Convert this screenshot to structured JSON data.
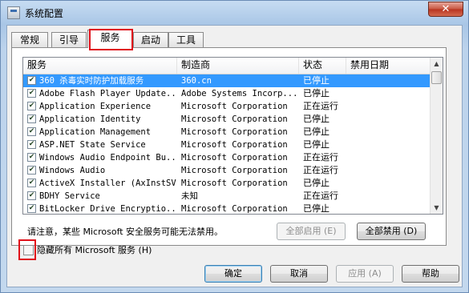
{
  "window": {
    "title": "系统配置",
    "close_glyph": "✕"
  },
  "tabs": [
    {
      "label": "常规"
    },
    {
      "label": "引导"
    },
    {
      "label": "服务"
    },
    {
      "label": "启动"
    },
    {
      "label": "工具"
    }
  ],
  "active_tab": "服务",
  "columns": [
    "服务",
    "制造商",
    "状态",
    "禁用日期"
  ],
  "services": [
    {
      "name": "360 杀毒实时防护加载服务",
      "vendor": "360.cn",
      "status": "已停止",
      "checked": true,
      "selected": true
    },
    {
      "name": "Adobe Flash Player Update...",
      "vendor": "Adobe Systems Incorp...",
      "status": "已停止",
      "checked": true
    },
    {
      "name": "Application Experience",
      "vendor": "Microsoft Corporation",
      "status": "正在运行",
      "checked": true
    },
    {
      "name": "Application Identity",
      "vendor": "Microsoft Corporation",
      "status": "已停止",
      "checked": true
    },
    {
      "name": "Application Management",
      "vendor": "Microsoft Corporation",
      "status": "已停止",
      "checked": true
    },
    {
      "name": "ASP.NET State Service",
      "vendor": "Microsoft Corporation",
      "status": "已停止",
      "checked": true
    },
    {
      "name": "Windows Audio Endpoint Bu...",
      "vendor": "Microsoft Corporation",
      "status": "正在运行",
      "checked": true
    },
    {
      "name": "Windows Audio",
      "vendor": "Microsoft Corporation",
      "status": "正在运行",
      "checked": true
    },
    {
      "name": "ActiveX Installer (AxInstSV)",
      "vendor": "Microsoft Corporation",
      "status": "已停止",
      "checked": true
    },
    {
      "name": "BDHY Service",
      "vendor": "未知",
      "status": "正在运行",
      "checked": true
    },
    {
      "name": "BitLocker Drive Encryptio...",
      "vendor": "Microsoft Corporation",
      "status": "已停止",
      "checked": true
    }
  ],
  "note": "请注意，某些 Microsoft 安全服务可能无法禁用。",
  "enable_all_label": "全部启用 (E)",
  "disable_all_label": "全部禁用 (D)",
  "hide_ms_label": "隐藏所有 Microsoft 服务 (H)",
  "hide_ms_checked": false,
  "buttons": {
    "ok": "确定",
    "cancel": "取消",
    "apply": "应用 (A)",
    "help": "帮助"
  },
  "accent_colors": {
    "highlight": "#e0101a",
    "selection": "#3399ff"
  }
}
